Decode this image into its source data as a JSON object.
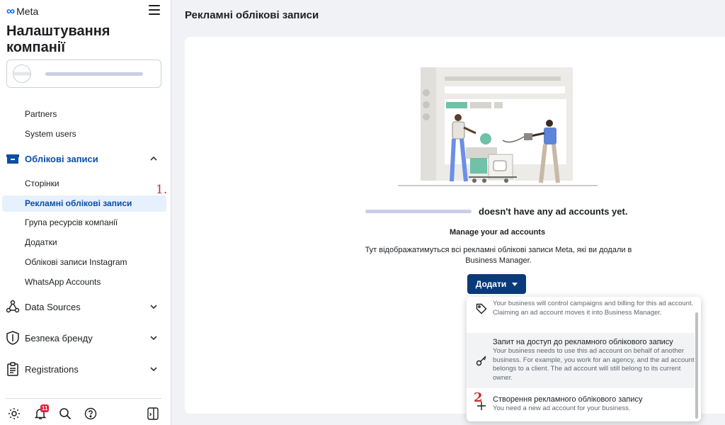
{
  "brand": {
    "logo_text": "Meta"
  },
  "sidebar": {
    "title": "Налаштування компанії",
    "upper_items": [
      "Partners",
      "System users"
    ],
    "accounts_section": {
      "label": "Облікові записи",
      "expanded": true
    },
    "account_items": [
      "Сторінки",
      "Рекламні облікові записи",
      "Група ресурсів компанії",
      "Додатки",
      "Облікові записи Instagram",
      "WhatsApp Accounts"
    ],
    "active_item": "Рекламні облікові записи",
    "collapsed_sections": [
      "Data Sources",
      "Безпека бренду",
      "Registrations"
    ],
    "notification_count": "11"
  },
  "annotations": {
    "step1": "1.",
    "step2": "2"
  },
  "main": {
    "page_title": "Рекламні облікові записи",
    "empty_state": "doesn't have any ad accounts yet.",
    "manage_title": "Manage your ad accounts",
    "description": "Тут відображатимуться всі рекламні облікові записи Meta, які ви додали в Business Manager.",
    "add_button": "Додати"
  },
  "dropdown": {
    "items": [
      {
        "title": "",
        "desc": "Your business will control campaigns and billing for this ad account. Claiming an ad account moves it into Business Manager.",
        "icon": "tag-icon"
      },
      {
        "title": "Запит на доступ до рекламного облікового запису",
        "desc": "Your business needs to use this ad account on behalf of another business. For example, you work for an agency, and the ad account belongs to a client. The ad account will still belong to its current owner.",
        "icon": "key-icon"
      },
      {
        "title": "Створення рекламного облікового запису",
        "desc": "You need a new ad account for your business.",
        "icon": "plus-icon"
      }
    ]
  },
  "colors": {
    "accent": "#0a4ea6",
    "button": "#0a3a7a",
    "annotation": "#c9302c",
    "badge": "#e41e3f"
  }
}
